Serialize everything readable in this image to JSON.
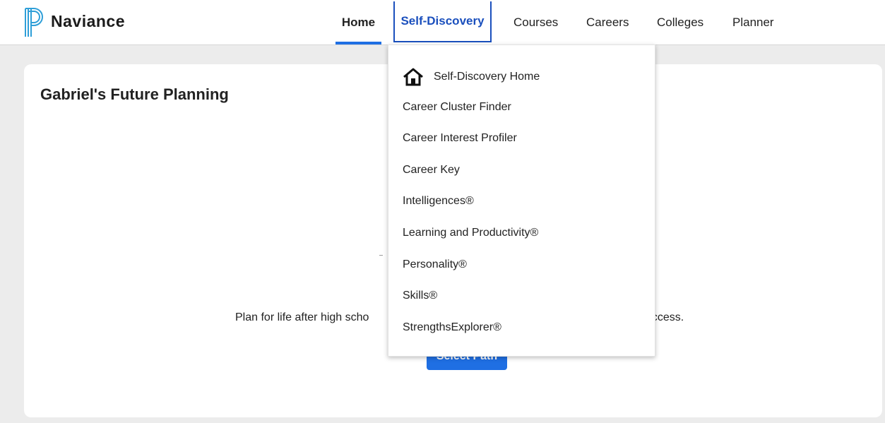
{
  "brand": "Naviance",
  "nav": {
    "home": "Home",
    "self_discovery": "Self-Discovery",
    "courses": "Courses",
    "careers": "Careers",
    "colleges": "Colleges",
    "planner": "Planner"
  },
  "card": {
    "title": "Gabriel's Future Planning",
    "description_visible_left": "Plan for life after high scho",
    "description_visible_right": "uccess.",
    "button_label": "Select Path"
  },
  "dropdown": {
    "home_icon": "house-icon",
    "items": [
      "Self-Discovery Home",
      "Career Cluster Finder",
      "Career Interest Profiler",
      "Career Key",
      "Intelligences®",
      "Learning and Productivity®",
      "Personality®",
      "Skills®",
      "StrengthsExplorer®"
    ]
  },
  "colors": {
    "accent": "#1f6fe3",
    "active_nav": "#1a4fbd",
    "background": "#ececec"
  }
}
